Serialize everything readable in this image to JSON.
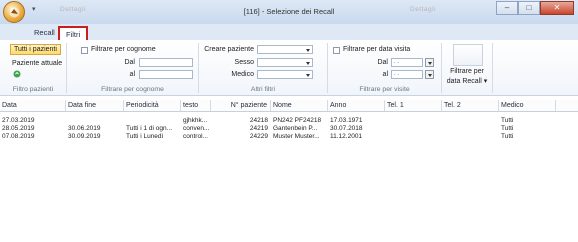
{
  "window": {
    "title": "[116] - Selezione dei Recall",
    "blurred_left": "Dettagli",
    "blurred_right": "Dettagli",
    "qat_items": [
      "qat-1",
      "qat-2"
    ]
  },
  "tabs": [
    {
      "label": "Recall",
      "active": false
    },
    {
      "label": "Filtri",
      "active": true
    }
  ],
  "ribbon": {
    "patient_filter": {
      "all_patients": "Tutti i pazienti",
      "current_patient": "Paziente attuale",
      "group_label": "Filtro pazienti"
    },
    "surname_filter": {
      "checkbox_label": "Filtrare per cognome",
      "from_label": "Dal",
      "to_label": "al",
      "from_value": "",
      "to_value": "",
      "group_label": "Filtrare per cognome"
    },
    "other_filters": {
      "create_patient_label": "Creare paziente",
      "sex_label": "Sesso",
      "doctor_label": "Medico",
      "create_patient_value": "",
      "sex_value": "",
      "doctor_value": "",
      "group_label": "Altri filtri"
    },
    "visit_filter": {
      "checkbox_label": "Filtrare per data visita",
      "from_label": "Dal",
      "to_label": "al",
      "from_value": ". .",
      "to_value": ". .",
      "group_label": "Filtrare per visite"
    },
    "recall_date": {
      "label_line1": "Filtrare per",
      "label_line2": "data Recall"
    }
  },
  "table": {
    "columns": [
      "Data",
      "Data fine",
      "Periodicità",
      "testo",
      "N° paziente",
      "Nome",
      "Anno",
      "Tel. 1",
      "Tel. 2",
      "Medico"
    ],
    "rows": [
      [
        "27.03.2019",
        "",
        "",
        "gjhkhk...",
        "24218",
        "PN242 PF24218",
        "17.03.1971",
        "",
        "",
        "Tutti"
      ],
      [
        "28.05.2019",
        "30.06.2019",
        "Tutti i 1 di ogn...",
        "conven...",
        "24219",
        "Gantenbein P...",
        "30.07.2018",
        "",
        "",
        "Tutti"
      ],
      [
        "07.08.2019",
        "30.09.2019",
        "Tutti i Lunedì",
        "control...",
        "24229",
        "Muster Muster...",
        "11.12.2001",
        "",
        "",
        "Tutti"
      ]
    ]
  },
  "colors": {
    "active_tab_border": "#c81e1e",
    "highlight_button": "#ffd968"
  }
}
